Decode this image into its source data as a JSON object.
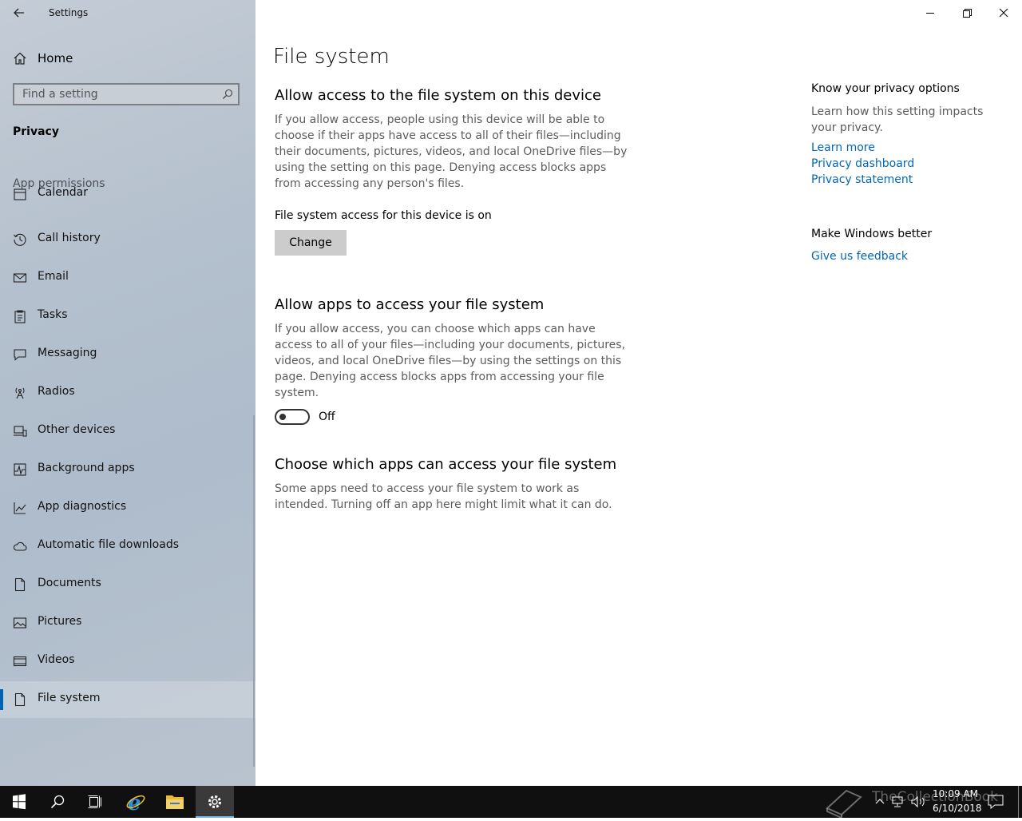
{
  "window": {
    "app_title": "Settings",
    "controls": {
      "minimize": "minimize",
      "restore": "restore",
      "close": "close"
    }
  },
  "sidebar": {
    "home_label": "Home",
    "search_placeholder": "Find a setting",
    "section_title": "Privacy",
    "group_title": "App permissions",
    "items": [
      {
        "label": "Calendar",
        "icon": "calendar-icon"
      },
      {
        "label": "Call history",
        "icon": "history-icon"
      },
      {
        "label": "Email",
        "icon": "mail-icon"
      },
      {
        "label": "Tasks",
        "icon": "clipboard-icon"
      },
      {
        "label": "Messaging",
        "icon": "chat-icon"
      },
      {
        "label": "Radios",
        "icon": "antenna-icon"
      },
      {
        "label": "Other devices",
        "icon": "devices-icon"
      },
      {
        "label": "Background apps",
        "icon": "pulse-icon"
      },
      {
        "label": "App diagnostics",
        "icon": "diagnostics-icon"
      },
      {
        "label": "Automatic file downloads",
        "icon": "cloud-icon"
      },
      {
        "label": "Documents",
        "icon": "document-icon"
      },
      {
        "label": "Pictures",
        "icon": "pictures-icon"
      },
      {
        "label": "Videos",
        "icon": "video-icon"
      },
      {
        "label": "File system",
        "icon": "file-icon",
        "selected": true
      }
    ]
  },
  "main": {
    "page_title": "File system",
    "section1": {
      "title": "Allow access to the file system on this device",
      "description": "If you allow access, people using this device will be able to choose if their apps have access to all of their files—including their documents, pictures, videos, and local OneDrive files—by using the setting on this page. Denying access blocks apps from accessing any person's files.",
      "status": "File system access for this device is on",
      "button_label": "Change"
    },
    "section2": {
      "title": "Allow apps to access your file system",
      "description": "If you allow access, you can choose which apps can have access to all of your files—including your documents, pictures, videos, and local OneDrive files—by using the settings on this page. Denying access blocks apps from accessing your file system.",
      "toggle_state": "Off"
    },
    "section3": {
      "title": "Choose which apps can access your file system",
      "description": "Some apps need to access your file system to work as intended. Turning off an app here might limit what it can do."
    }
  },
  "right_panel": {
    "privacy_title": "Know your privacy options",
    "privacy_desc": "Learn how this setting impacts your privacy.",
    "links": [
      "Learn more",
      "Privacy dashboard",
      "Privacy statement"
    ],
    "better_title": "Make Windows better",
    "feedback_link": "Give us feedback"
  },
  "taskbar": {
    "time": "10:09 AM",
    "date": "6/10/2018",
    "watermark": "TheCollectionBook",
    "accent": "#76b9ed"
  }
}
